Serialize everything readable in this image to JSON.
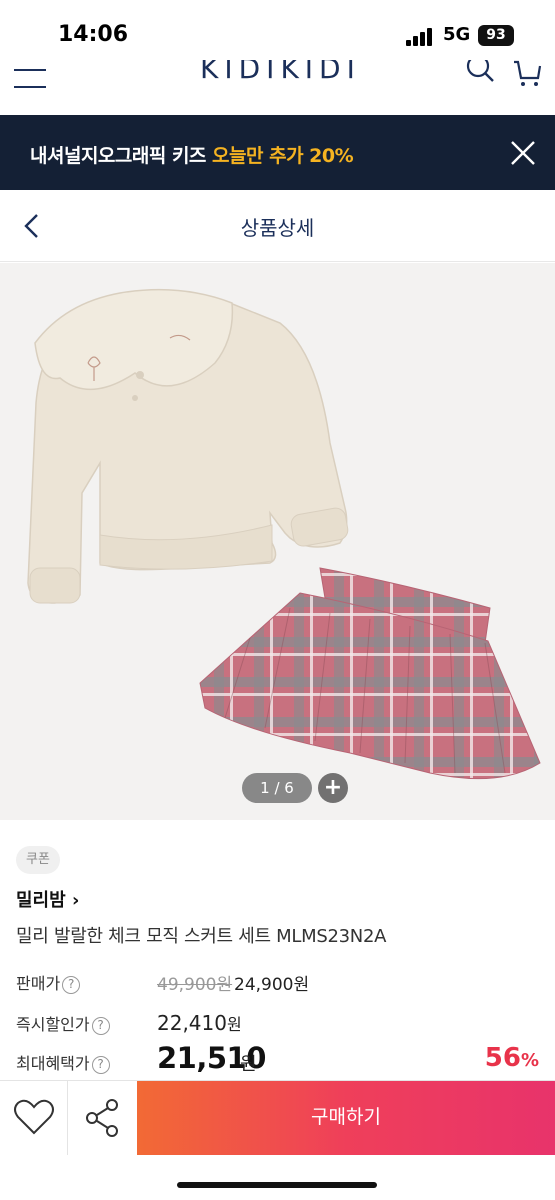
{
  "status": {
    "time": "14:06",
    "network": "5G",
    "battery": "93"
  },
  "nav": {
    "logo": "KIDIKIDI"
  },
  "banner": {
    "text_prefix": "내셔널지오그래픽 키즈 ",
    "highlight": "오늘만 추가 20%"
  },
  "header": {
    "title": "상품상세"
  },
  "gallery": {
    "pager": "1 / 6",
    "plus": "+"
  },
  "product": {
    "coupon": "쿠폰",
    "brand": "밀리밤",
    "name": "밀리 발랄한 체크 모직 스커트 세트 MLMS23N2A"
  },
  "prices": {
    "sale_label": "판매가",
    "original": "49,900원",
    "sale": "24,900원",
    "instant_label": "즉시할인가",
    "instant_value": "22,410",
    "instant_unit": "원",
    "max_label": "최대혜택가",
    "max_value": "21,510",
    "max_unit": "원",
    "discount_pct": "56",
    "discount_sym": "%"
  },
  "bottom": {
    "buy_label": "구매하기"
  },
  "colors": {
    "navy": "#142035",
    "accent": "#f5b321",
    "discount": "#e8334a",
    "buy_start": "#f26a35",
    "buy_end": "#e8336b"
  }
}
